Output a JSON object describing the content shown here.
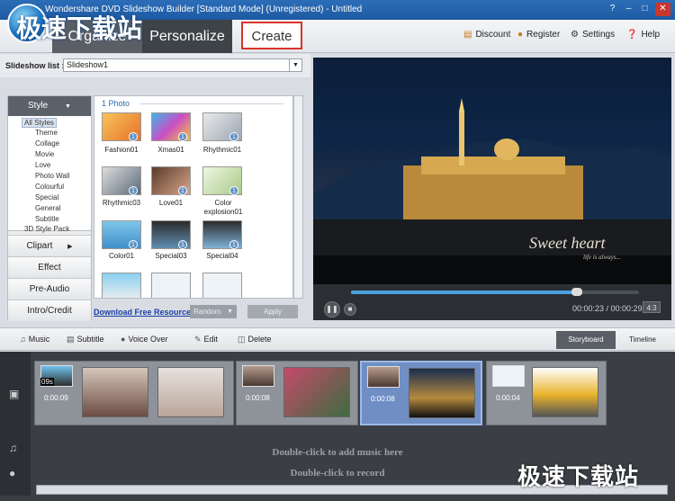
{
  "app": {
    "title": "Wondershare DVD Slideshow Builder [Standard Mode] (Unregistered) - Untitled",
    "window_controls": [
      "?",
      "–",
      "□",
      "✕"
    ],
    "watermark_top": "极速下载站",
    "watermark_bottom": "极速下载站"
  },
  "toolbar": {
    "tabs": [
      {
        "label": "Organize"
      },
      {
        "label": "Personalize"
      },
      {
        "label": "Create"
      }
    ],
    "links": [
      {
        "label": "Discount",
        "icon": "cart-icon"
      },
      {
        "label": "Register",
        "icon": "user-icon"
      },
      {
        "label": "Settings",
        "icon": "gear-icon"
      },
      {
        "label": "Help",
        "icon": "help-icon"
      }
    ]
  },
  "slideshow_list": {
    "label": "Slideshow list :",
    "value": "Slideshow1"
  },
  "categories": {
    "header": "Style",
    "tree": [
      "All Styles",
      "Theme",
      "Collage",
      "Movie",
      "Love",
      "Photo Wall",
      "Colourful",
      "Special",
      "General",
      "Subtitle",
      "3D Style Pack"
    ],
    "buttons": [
      "Clipart",
      "Effect",
      "Pre-Audio",
      "Intro/Credit"
    ]
  },
  "grid": {
    "header": "1 Photo",
    "items": [
      {
        "label": "Fashion01"
      },
      {
        "label": "Xmas01"
      },
      {
        "label": "Rhythmic01"
      },
      {
        "label": "Rhythmic03"
      },
      {
        "label": "Love01"
      },
      {
        "label": "Color explosion01"
      },
      {
        "label": "Color01"
      },
      {
        "label": "Special03"
      },
      {
        "label": "Special04"
      }
    ],
    "download_link": "Download Free Resource",
    "random_label": "Random",
    "apply_label": "Apply"
  },
  "preview": {
    "overlay_title": "Sweet heart",
    "overlay_sub": "life is always...",
    "time": "00:00:23 / 00:00:29",
    "ratio": "4:3",
    "progress": 0.785
  },
  "edit_toolbar": {
    "buttons": [
      "Music",
      "Subtitle",
      "Voice Over",
      "Edit",
      "Delete"
    ],
    "view_tabs": [
      "Storyboard",
      "Timeline"
    ]
  },
  "storyboard": {
    "scenes": [
      {
        "time": "0:00:09",
        "badge": "09s"
      },
      {
        "time": "0:00:08"
      },
      {
        "time": "0:00:08"
      },
      {
        "time": "0:00:04"
      }
    ],
    "music_hint": "Double-click to add music here",
    "record_hint": "Double-click to record"
  }
}
